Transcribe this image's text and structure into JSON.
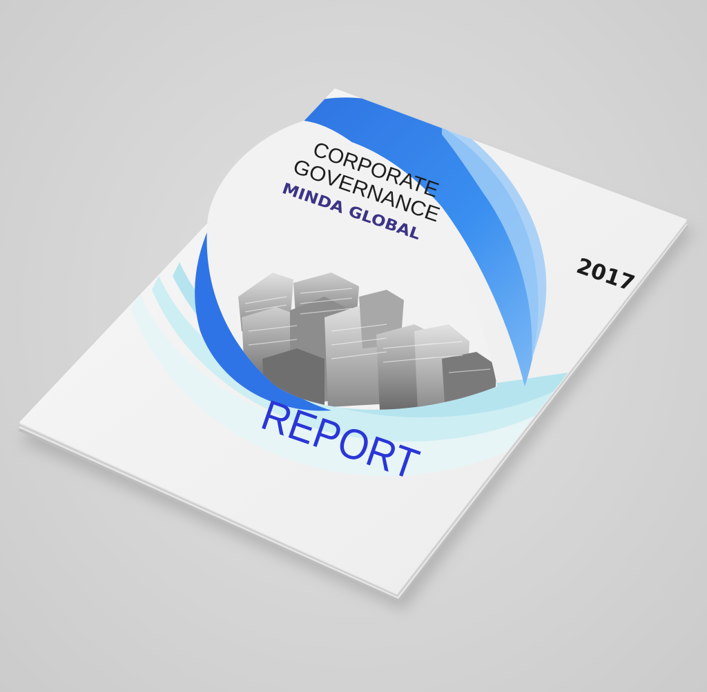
{
  "cover": {
    "title_line1": "CORPORATE",
    "title_line2": "GOVERNANCE",
    "company": "MINDA GLOBAL",
    "year": "2017",
    "report_label": "REPORT"
  },
  "colors": {
    "background": "#d6d6d6",
    "page": "#f4f4f4",
    "swoosh_primary": "#2f7fe8",
    "swoosh_light": "#a9d8f5",
    "swoosh_cyan": "#cfeff4",
    "company_text": "#3b3486",
    "report_text": "#2a36d6",
    "title_text": "#1d1d1d"
  },
  "icons": {
    "skyline": "city-skyline-illustration"
  }
}
